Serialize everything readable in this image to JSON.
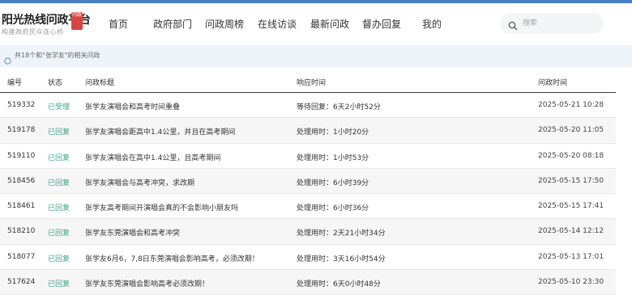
{
  "header": {
    "title": "阳光热线问政平台",
    "subtitle": "构建政府民众连心桥",
    "seal_text": "问政",
    "nav": [
      {
        "label": "首页"
      },
      {
        "label": "政府部门"
      },
      {
        "label": "问政周榜"
      },
      {
        "label": "在线访谈"
      },
      {
        "label": "最新问政"
      },
      {
        "label": "督办回复"
      },
      {
        "label": "我的"
      }
    ],
    "search": {
      "placeholder": "搜索"
    }
  },
  "notice": {
    "text": "共18个和\"张学友\"的相关问政"
  },
  "table": {
    "columns": [
      "编号",
      "状态",
      "问政标题",
      "响应时间",
      "问政时间"
    ],
    "rows": [
      {
        "id": "519332",
        "status": "已受理",
        "title": "张学友演唱会和高考时间重叠",
        "response": "等待回复：6天2小时52分",
        "time": "2025-05-21 10:28"
      },
      {
        "id": "519178",
        "status": "已回复",
        "title": "张学友演唱会距高中1.4公里，并且在高考期间",
        "response": "处理用时：1小时20分",
        "time": "2025-05-20 11:05"
      },
      {
        "id": "519110",
        "status": "已回复",
        "title": "张学友演唱会在高中1.4公里，且高考期间",
        "response": "处理用时：1小时53分",
        "time": "2025-05-20 08:18"
      },
      {
        "id": "518456",
        "status": "已回复",
        "title": "张学友演唱会与高考冲突，求改期",
        "response": "处理用时：6小时39分",
        "time": "2025-05-15 17:50"
      },
      {
        "id": "518461",
        "status": "已回复",
        "title": "张学友高考期间开演唱会真的不会影响小朋友吗",
        "response": "处理用时：6小时36分",
        "time": "2025-05-15 17:41"
      },
      {
        "id": "518210",
        "status": "已回复",
        "title": "张学友东莞演唱会和高考冲突",
        "response": "处理用时：2天21小时34分",
        "time": "2025-05-14 12:12"
      },
      {
        "id": "518077",
        "status": "已回复",
        "title": "张学友6月6，7,8日东莞演唱会影响高考，必须改期！",
        "response": "处理用时：3天16小时54分",
        "time": "2025-05-13 17:01"
      },
      {
        "id": "517624",
        "status": "已回复",
        "title": "张学友东莞演唱会影响高考必须改期！",
        "response": "处理用时：6天0小时48分",
        "time": "2025-05-10 23:30"
      }
    ]
  },
  "colors": {
    "accent": "#4a7fc4",
    "status_green": "#3aa58a",
    "notice_bg": "#eef4fa",
    "seal_red": "#d9443e"
  },
  "icons": {
    "search": "search-icon",
    "notice": "info-circle-icon"
  }
}
